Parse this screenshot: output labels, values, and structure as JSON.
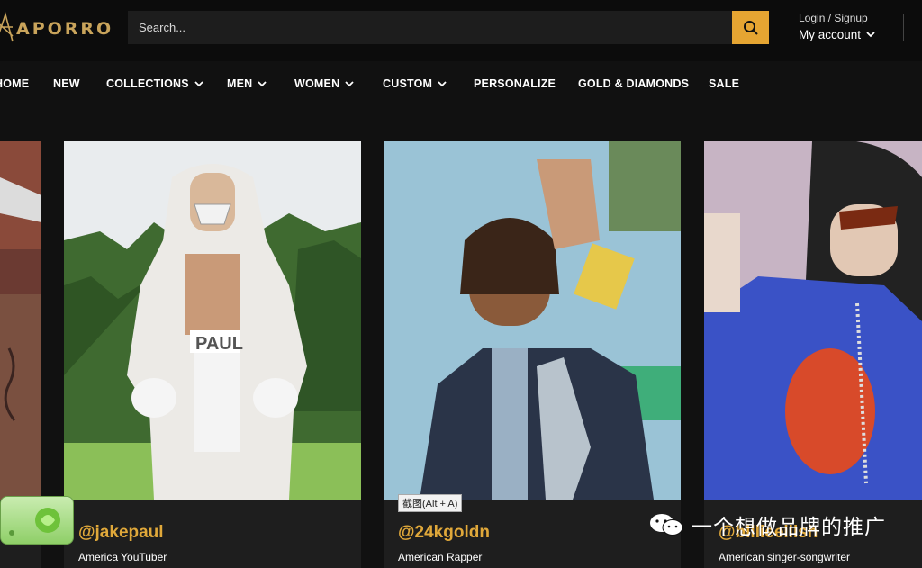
{
  "header": {
    "logo_text": "APORRO",
    "search_placeholder": "Search...",
    "login_text": "Login / Signup",
    "account_text": "My account"
  },
  "nav": {
    "items": [
      {
        "label": "HOME"
      },
      {
        "label": "NEW"
      },
      {
        "label": "COLLECTIONS"
      },
      {
        "label": "MEN"
      },
      {
        "label": "WOMEN"
      },
      {
        "label": "CUSTOM"
      },
      {
        "label": "PERSONALIZE"
      },
      {
        "label": "GOLD & DIAMONDS"
      },
      {
        "label": "SALE"
      }
    ]
  },
  "cards": [
    {
      "handle": "@jakepaul",
      "role": "America YouTuber",
      "photo_text": "PAUL"
    },
    {
      "handle": "@24kgoldn",
      "role": "American Rapper"
    },
    {
      "handle": "@billieeilish",
      "role": "American singer-songwriter"
    }
  ],
  "overlay": {
    "capture_tip": "截图(Alt + A)",
    "watermark_text": "一个想做品牌的推广"
  },
  "colors": {
    "accent": "#e0a83a",
    "search_button": "#e6a532",
    "background": "#111111"
  }
}
